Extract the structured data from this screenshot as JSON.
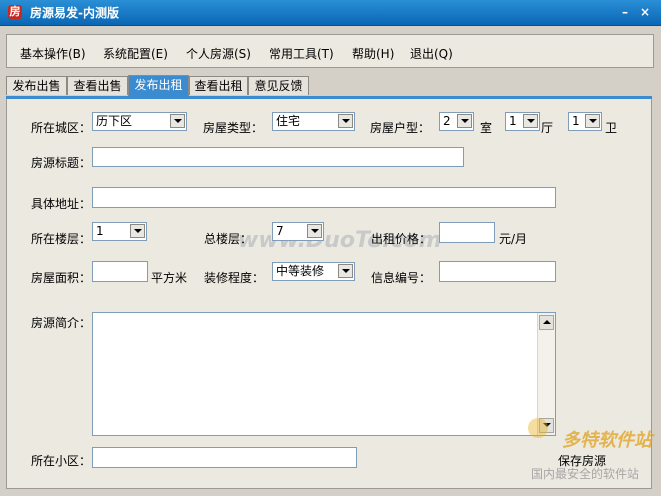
{
  "window": {
    "title": "房源易发-内测版",
    "app_icon": "房"
  },
  "menu": [
    {
      "label": "基本操作(B)"
    },
    {
      "label": "系统配置(E)"
    },
    {
      "label": "个人房源(S)"
    },
    {
      "label": "常用工具(T)"
    },
    {
      "label": "帮助(H)"
    },
    {
      "label": "退出(Q)"
    }
  ],
  "tabs": [
    {
      "label": "发布出售"
    },
    {
      "label": "查看出售"
    },
    {
      "label": "发布出租",
      "active": true
    },
    {
      "label": "查看出租"
    },
    {
      "label": "意见反馈"
    }
  ],
  "form": {
    "district_label": "所在城区：",
    "district_value": "历下区",
    "house_type_label": "房屋类型：",
    "house_type_value": "住宅",
    "layout_label": "房屋户型：",
    "rooms_value": "2",
    "rooms_unit": "室",
    "halls_value": "1",
    "halls_unit": "厅",
    "baths_value": "1",
    "baths_unit": "卫",
    "title_label": "房源标题：",
    "address_label": "具体地址：",
    "floor_label": "所在楼层：",
    "floor_value": "1",
    "total_floor_label": "总楼层：",
    "total_floor_value": "7",
    "rent_label": "出租价格：",
    "rent_unit": "元/月",
    "area_label": "房屋面积：",
    "area_unit": "平方米",
    "decoration_label": "装修程度：",
    "decoration_value": "中等装修",
    "info_no_label": "信息编号：",
    "intro_label": "房源简介：",
    "community_label": "所在小区：",
    "save_label": "保存房源"
  },
  "watermark": {
    "center": "www.DuoTe.com",
    "brand": "多特软件站",
    "slogan": "国内最安全的软件站",
    "brand_color": "#e0a21c"
  }
}
